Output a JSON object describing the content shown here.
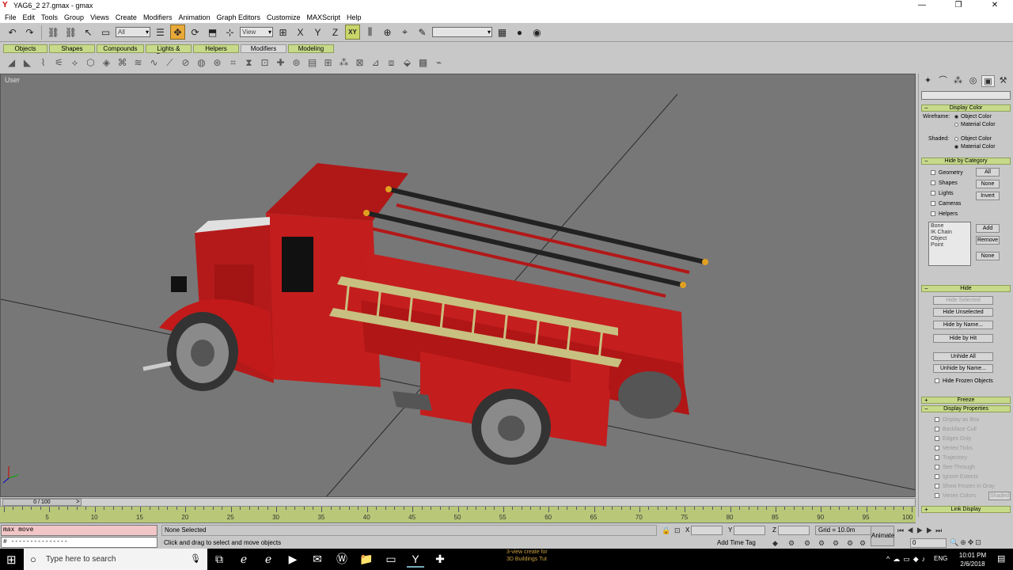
{
  "window": {
    "title": "YAG6_2 27.gmax - gmax",
    "controls": [
      "—",
      "❐",
      "✕"
    ]
  },
  "menu": [
    "File",
    "Edit",
    "Tools",
    "Group",
    "Views",
    "Create",
    "Modifiers",
    "Animation",
    "Graph Editors",
    "Customize",
    "MAXScript",
    "Help"
  ],
  "toolbar": {
    "selection_filter": "All",
    "reference_coord": "View",
    "axis_constraint": "XY",
    "named_selection": ""
  },
  "tabs": [
    "Objects",
    "Shapes",
    "Compounds",
    "Lights & Cameras",
    "Helpers",
    "Modifiers",
    "Modeling"
  ],
  "viewport": {
    "label": "User"
  },
  "panel": {
    "display_color": {
      "title": "Display Color",
      "wireframe_label": "Wireframe:",
      "shaded_label": "Shaded:",
      "option_object": "Object Color",
      "option_material": "Material Color"
    },
    "hide_by_category": {
      "title": "Hide by Category",
      "items": [
        "Geometry",
        "Shapes",
        "Lights",
        "Cameras",
        "Helpers"
      ],
      "buttons": [
        "All",
        "None",
        "Invert"
      ],
      "list": [
        "Bone",
        "IK Chain Object",
        "Point"
      ],
      "list_buttons": [
        "Add",
        "Remove",
        "None"
      ]
    },
    "hide": {
      "title": "Hide",
      "buttons": [
        "Hide Selected",
        "Hide Unselected",
        "Hide by Name...",
        "Hide by Hit"
      ],
      "unhide": [
        "Unhide All",
        "Unhide by Name..."
      ],
      "frozen": "Hide Frozen Objects"
    },
    "freeze": {
      "title": "Freeze"
    },
    "display_properties": {
      "title": "Display Properties",
      "items": [
        "Display as Box",
        "Backface Cull",
        "Edges Only",
        "Vertex Ticks",
        "Trajectory",
        "See-Through",
        "Ignore Extents",
        "Show Frozen in Gray",
        "Vertex Colors"
      ],
      "shaded_btn": "Shaded"
    },
    "link_display": {
      "title": "Link Display"
    }
  },
  "timeline": {
    "slider": "0 / 100",
    "ticks": [
      "5",
      "10",
      "15",
      "20",
      "25",
      "30",
      "35",
      "40",
      "45",
      "50",
      "55",
      "60",
      "65",
      "70",
      "75",
      "80",
      "85",
      "90",
      "95",
      "100"
    ]
  },
  "status": {
    "maxscript_line1": "max move",
    "maxscript_line2": "# ---------------",
    "selection": "None Selected",
    "prompt": "Click and drag to select and move objects",
    "x_label": "X",
    "y_label": "Y",
    "z_label": "Z",
    "grid": "Grid = 10.0m",
    "add_time_tag": "Add Time Tag",
    "animate": "Animate",
    "frame": "0"
  },
  "taskbar": {
    "search_placeholder": "Type here to search",
    "hidden_items": [
      "3-view create for",
      "3D Buildings Tut"
    ],
    "language": "ENG",
    "time": "10:01 PM",
    "date": "2/6/2018"
  }
}
